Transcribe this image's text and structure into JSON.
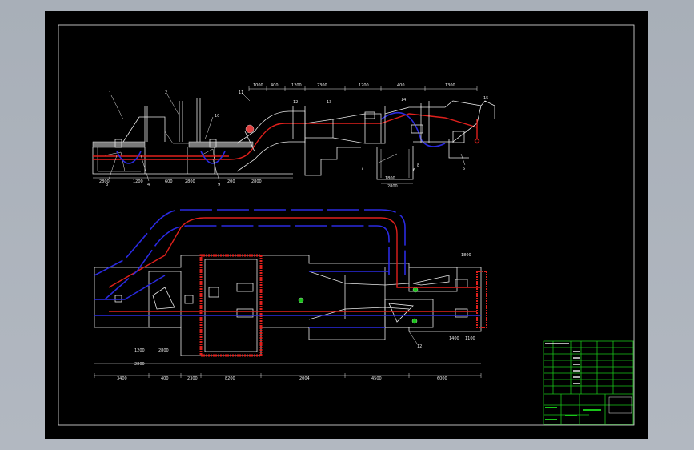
{
  "drawing": {
    "background": "#000000",
    "line_color": "#e8e8e8",
    "accent_red": "#e0201c",
    "accent_blue": "#2a2ae0",
    "accent_green": "#19c419",
    "frame_bg": "#a9b0b9"
  },
  "section_view": {
    "top_dims": [
      "1000",
      "400",
      "1200",
      "2300",
      "1200",
      "400",
      "1300"
    ],
    "bottom_dims": [
      "2800",
      "1200",
      "600",
      "2800",
      "200",
      "2800",
      "1800",
      "2800"
    ],
    "leaders": [
      "1",
      "2",
      "3",
      "4",
      "5",
      "6",
      "7",
      "8",
      "9",
      "10",
      "11",
      "12",
      "13",
      "14",
      "15"
    ]
  },
  "plan_view": {
    "bottom_dims": [
      "3400",
      "400",
      "2300",
      "8200",
      "2004",
      "4500",
      "6000"
    ],
    "left_dims": [
      "1200",
      "2800",
      "2800"
    ],
    "right_dims": [
      "1800",
      "1400",
      "1100"
    ],
    "leaders": [
      "12"
    ]
  },
  "title_block": {
    "rows": 12
  }
}
